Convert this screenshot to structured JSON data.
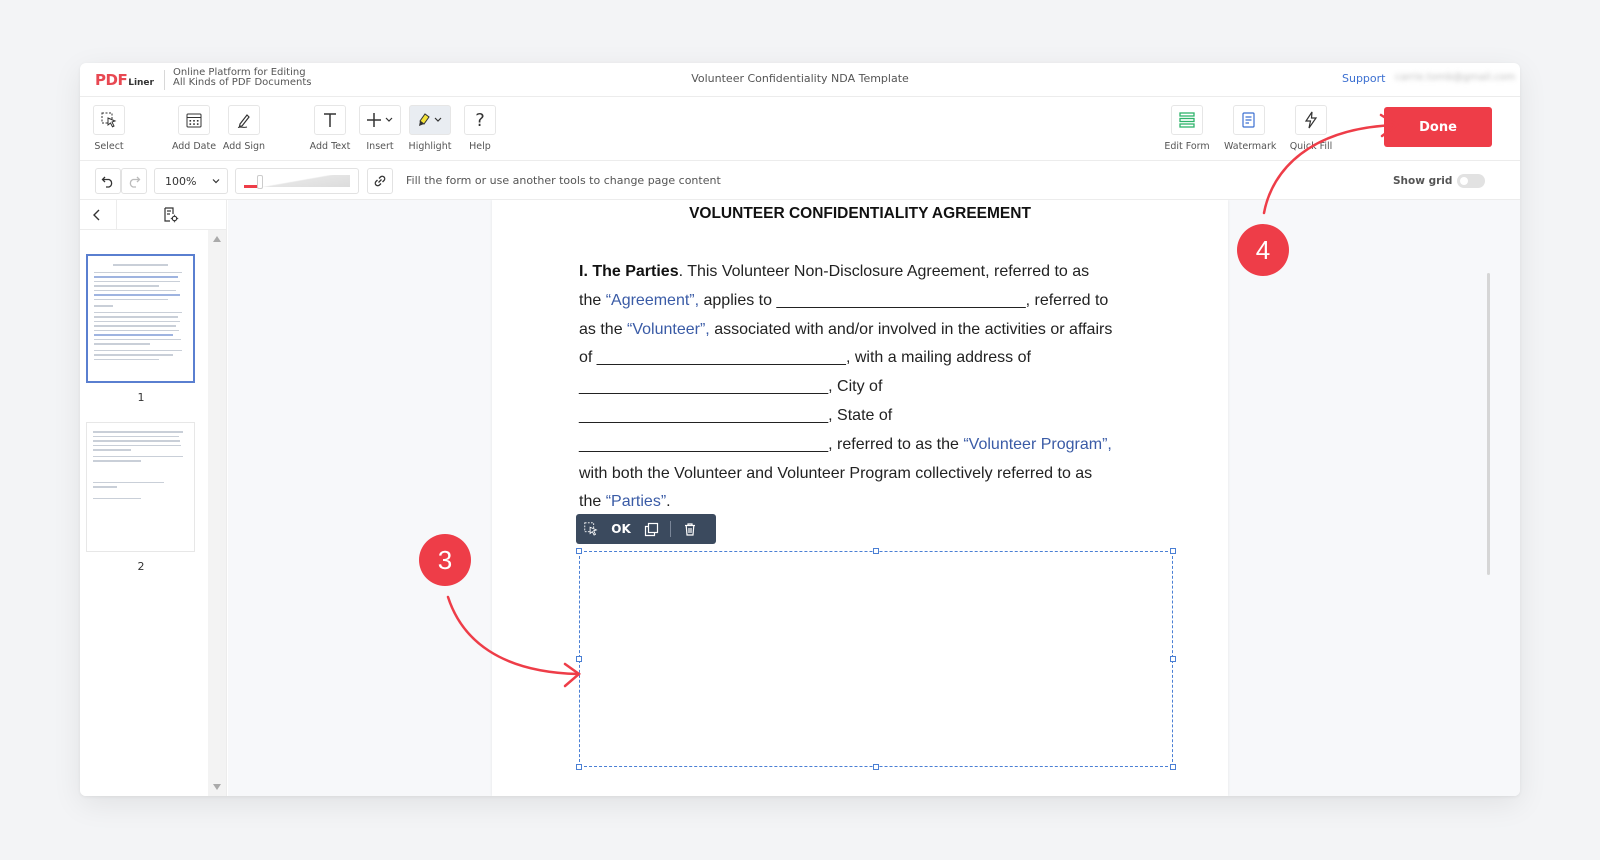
{
  "header": {
    "logo_main": "PDF",
    "logo_sub": "Liner",
    "tagline_line1": "Online Platform for Editing",
    "tagline_line2": "All Kinds of PDF Documents",
    "doc_title": "Volunteer Confidentiality NDA Template",
    "support": "Support",
    "email": "carrie.tomb@gmail.com"
  },
  "toolbar": {
    "select": "Select",
    "add_date": "Add Date",
    "add_sign": "Add Sign",
    "add_text": "Add Text",
    "insert": "Insert",
    "highlight": "Highlight",
    "help": "Help",
    "edit_form": "Edit Form",
    "watermark": "Watermark",
    "quick_fill": "Quick Fill",
    "done": "Done"
  },
  "subbar": {
    "zoom": "100%",
    "zoom_level": 0.15,
    "hint": "Fill the form or use another tools to change page content",
    "show_grid": "Show grid",
    "show_grid_on": false
  },
  "sidebar": {
    "pages": [
      "1",
      "2"
    ],
    "selected_page": "1"
  },
  "document": {
    "heading": "VOLUNTEER CONFIDENTIALITY AGREEMENT",
    "l1_bold": "I. The Parties",
    "l1_text": ". This Volunteer Non-Disclosure Agreement, referred to as",
    "l2_a": "the ",
    "l2_blue": "“Agreement”,",
    "l2_b": " applies to ____________________________, referred to",
    "l3_a": "as the ",
    "l3_blue": "“Volunteer”,",
    "l3_b": " associated with and/or involved in the activities or affairs",
    "l4": "of ____________________________, with a mailing address of",
    "l5": "____________________________, City of",
    "l6": "____________________________, State of",
    "l7_a": "____________________________, referred to as the ",
    "l7_blue": "“Volunteer Program”,",
    "l8": "with both the Volunteer and Volunteer Program collectively referred to as",
    "l9_a": "the ",
    "l9_blue": "“Parties”",
    "l9_b": "."
  },
  "field_toolbar": {
    "ok": "OK"
  },
  "annotations": {
    "step3": "3",
    "step4": "4"
  },
  "colors": {
    "accent": "#ee3d48",
    "link_blue": "#3a5ba6",
    "selection": "#4a7fd4"
  }
}
